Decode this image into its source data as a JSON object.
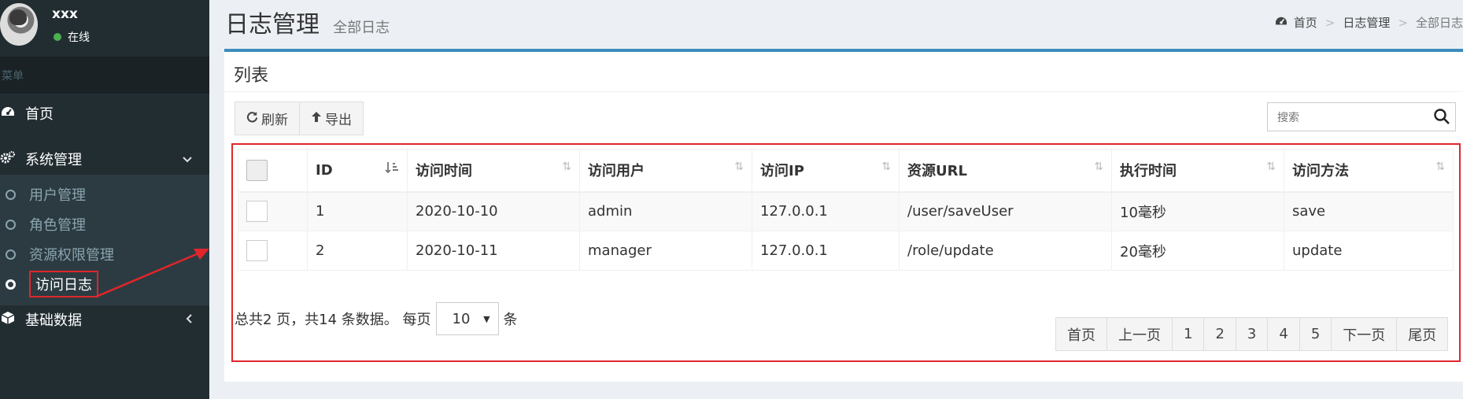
{
  "user": {
    "name": "xxx",
    "status": "在线"
  },
  "sidebar": {
    "menu_header": "菜单",
    "home_label": "首页",
    "system_label": "系统管理",
    "submenu": [
      {
        "label": "用户管理"
      },
      {
        "label": "角色管理"
      },
      {
        "label": "资源权限管理"
      },
      {
        "label": "访问日志"
      }
    ],
    "basic_data_label": "基础数据"
  },
  "header": {
    "title": "日志管理",
    "subtitle": "全部日志",
    "breadcrumb": [
      "首页",
      "日志管理",
      "全部日志"
    ]
  },
  "box": {
    "title": "列表",
    "refresh_label": "刷新",
    "export_label": "导出",
    "search_placeholder": "搜索"
  },
  "table": {
    "columns": [
      "ID",
      "访问时间",
      "访问用户",
      "访问IP",
      "资源URL",
      "执行时间",
      "访问方法"
    ],
    "rows": [
      [
        "1",
        "2020-10-10",
        "admin",
        "127.0.0.1",
        "/user/saveUser",
        "10毫秒",
        "save"
      ],
      [
        "2",
        "2020-10-11",
        "manager",
        "127.0.0.1",
        "/role/update",
        "20毫秒",
        "update"
      ]
    ]
  },
  "pager": {
    "summary": "总共2 页，共14 条数据。 每页",
    "page_size": "10",
    "unit": "条",
    "buttons": [
      "首页",
      "上一页",
      "1",
      "2",
      "3",
      "4",
      "5",
      "下一页",
      "尾页"
    ]
  },
  "colors": {
    "accent": "#3c8dbc",
    "highlight": "#e0262a",
    "sidebar": "#222d32"
  }
}
